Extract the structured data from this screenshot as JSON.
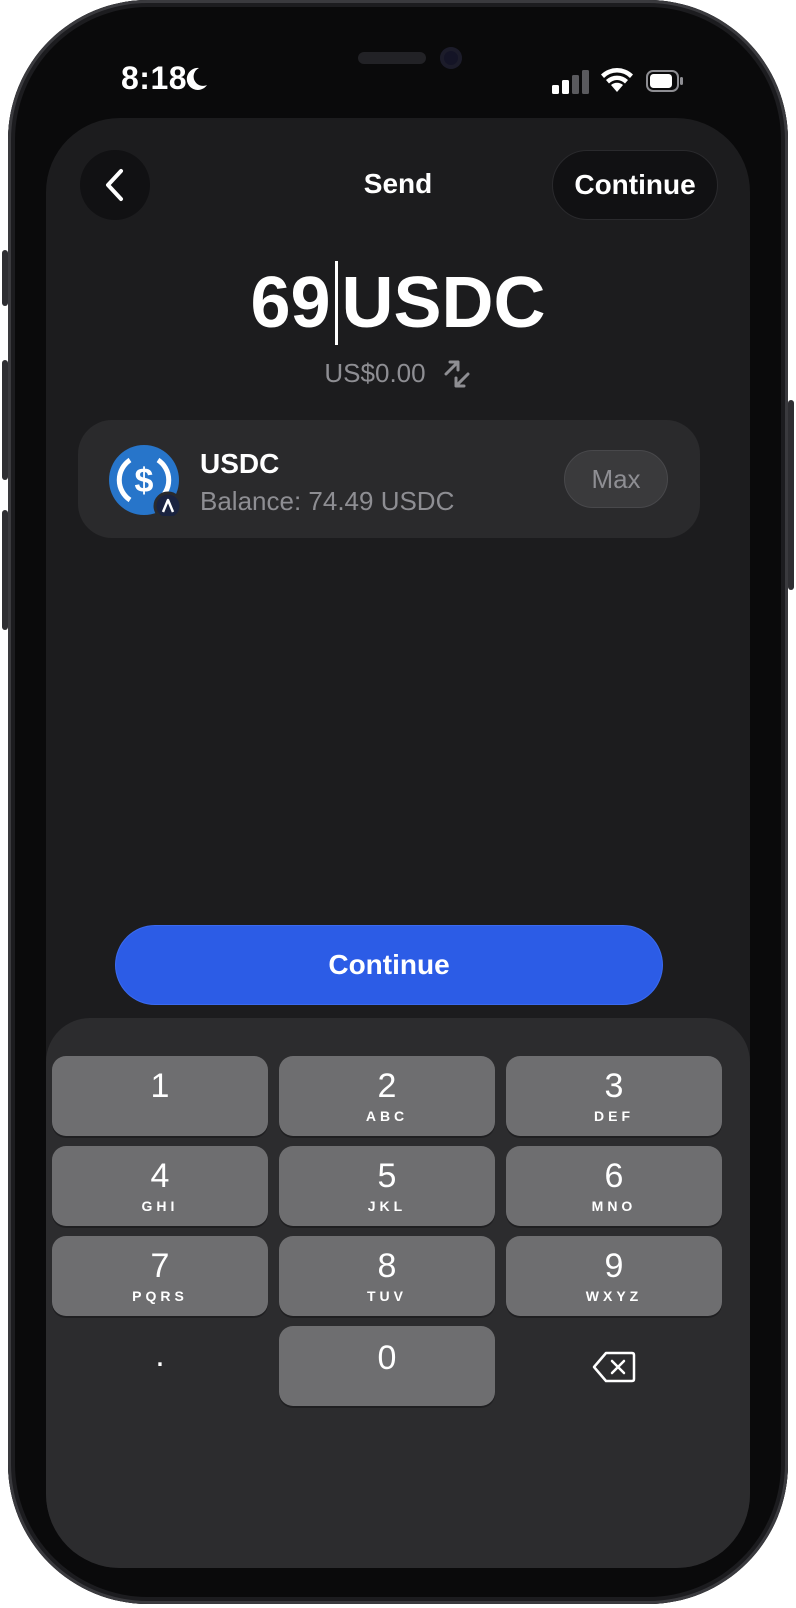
{
  "status": {
    "time": "8:18"
  },
  "header": {
    "title": "Send",
    "continue_label": "Continue"
  },
  "amount": {
    "value": "69",
    "unit": "USDC",
    "fiat": "US$0.00"
  },
  "token": {
    "name": "USDC",
    "balance": "Balance: 74.49 USDC",
    "max_label": "Max"
  },
  "primary": {
    "continue_label": "Continue"
  },
  "keypad": {
    "keys": [
      {
        "digit": "1",
        "letters": ""
      },
      {
        "digit": "2",
        "letters": "ABC"
      },
      {
        "digit": "3",
        "letters": "DEF"
      },
      {
        "digit": "4",
        "letters": "GHI"
      },
      {
        "digit": "5",
        "letters": "JKL"
      },
      {
        "digit": "6",
        "letters": "MNO"
      },
      {
        "digit": "7",
        "letters": "PQRS"
      },
      {
        "digit": "8",
        "letters": "TUV"
      },
      {
        "digit": "9",
        "letters": "WXYZ"
      },
      {
        "digit": ".",
        "letters": ""
      },
      {
        "digit": "0",
        "letters": ""
      }
    ]
  },
  "colors": {
    "accent": "#2c5ce6",
    "background": "#1c1c1e",
    "card": "#2a2a2c",
    "key": "#6e6e70",
    "muted": "#8e8e93"
  },
  "icons": {
    "back": "chevron-left-icon",
    "swap": "swap-arrows-icon",
    "backspace": "backspace-icon",
    "token": "usdc-logo-icon",
    "wifi": "wifi-icon",
    "signal": "cellular-signal-icon",
    "battery": "battery-icon",
    "moon": "moon-icon"
  }
}
